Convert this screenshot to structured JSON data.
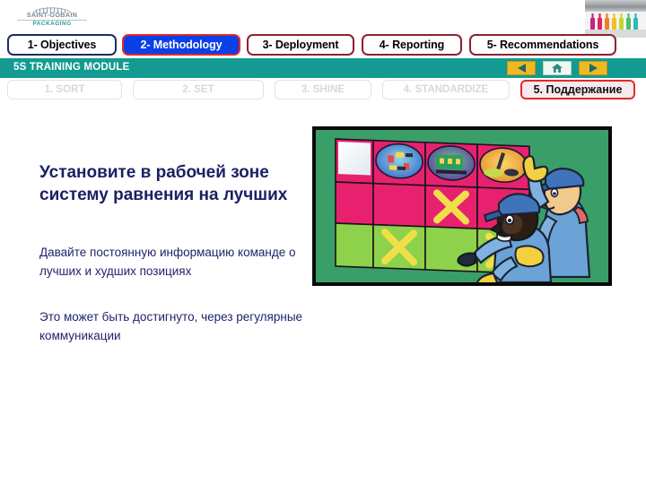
{
  "brand": {
    "name": "SAINT-GOBAIN",
    "sub": "PACKAGING",
    "logo_icon": "arch-icon"
  },
  "decor": {
    "bottles_icon": "bottles-photo",
    "bottle_colors": [
      "#c9247c",
      "#e0245e",
      "#ef7f2a",
      "#f2c11e",
      "#c3d62e",
      "#4fbf6a",
      "#2fb8c0"
    ]
  },
  "main_tabs": [
    {
      "label": "1- Objectives",
      "name": "tab-objectives",
      "active": false
    },
    {
      "label": "2- Methodology",
      "name": "tab-methodology",
      "active": true
    },
    {
      "label": "3- Deployment",
      "name": "tab-deployment",
      "active": false
    },
    {
      "label": "4- Reporting",
      "name": "tab-reporting",
      "active": false
    },
    {
      "label": "5- Recommendations",
      "name": "tab-recommendations",
      "active": false
    }
  ],
  "module_bar": {
    "title": "5S TRAINING MODULE",
    "background": "#139b91",
    "prev_icon": "triangle-left-icon",
    "home_icon": "home-icon",
    "next_icon": "triangle-right-icon"
  },
  "sub_tabs": [
    {
      "label": "1. SORT",
      "name": "subtab-sort",
      "active": false
    },
    {
      "label": "2. SET",
      "name": "subtab-set",
      "active": false
    },
    {
      "label": "3. SHINE",
      "name": "subtab-shine",
      "active": false
    },
    {
      "label": "4. STANDARDIZE",
      "name": "subtab-standardize",
      "active": false
    },
    {
      "label": "5. Поддержание",
      "name": "subtab-sustain",
      "active": true
    }
  ],
  "content": {
    "heading": "Установите в рабочей зоне систему равнения на лучших",
    "para1": "Давайте постоянную информацию команде о лучших и худших позициях",
    "para2": "Это может быть достигнуто, через регулярные коммуникации",
    "heading_color": "#1b1f63",
    "body_color": "#20246b"
  },
  "illustration": {
    "name": "workers-at-scoreboard-illustration",
    "background": "#3a9e68",
    "board": {
      "rows": 3,
      "cols": 4,
      "row_colors": [
        "#e8216f",
        "#e8216f",
        "#8ed14a"
      ],
      "mark_color": "#efe04a",
      "marks": [
        {
          "row": 2,
          "col": 3
        },
        {
          "row": 3,
          "col": 2
        },
        {
          "row": 3,
          "col": 4
        }
      ],
      "thumbnails": [
        "blank-white",
        "photo-blue",
        "photo-purple",
        "photo-orange"
      ]
    },
    "workers": 2,
    "worker_colors": {
      "uniform": "#6ba3d6",
      "glove": "#f2d040",
      "cap": "#3f74bb"
    }
  }
}
